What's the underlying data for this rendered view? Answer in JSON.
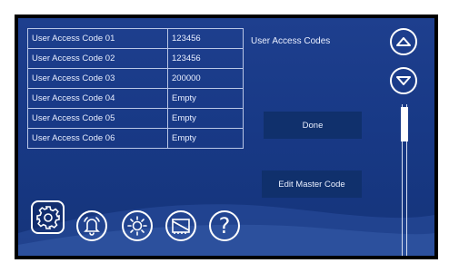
{
  "table": {
    "rows": [
      {
        "name": "User Access Code 01",
        "value": "123456"
      },
      {
        "name": "User Access Code 02",
        "value": "123456"
      },
      {
        "name": "User Access Code 03",
        "value": "200000"
      },
      {
        "name": "User Access Code 04",
        "value": "Empty"
      },
      {
        "name": "User Access Code 05",
        "value": "Empty"
      },
      {
        "name": "User Access Code 06",
        "value": "Empty"
      }
    ]
  },
  "section_title": "User Access Codes",
  "buttons": {
    "done": "Done",
    "edit_master": "Edit Master Code"
  },
  "help_glyph": "?",
  "icons": {
    "nav_up": "chevron-up-icon",
    "nav_down": "chevron-down-icon",
    "settings": "gear-icon",
    "alarm": "bell-icon",
    "brightness": "sun-icon",
    "display": "screen-icon",
    "help": "question-icon"
  },
  "colors": {
    "background": "#1c3d8a",
    "button": "#10306c",
    "text": "#e9efff",
    "border": "#b9c6e6"
  }
}
